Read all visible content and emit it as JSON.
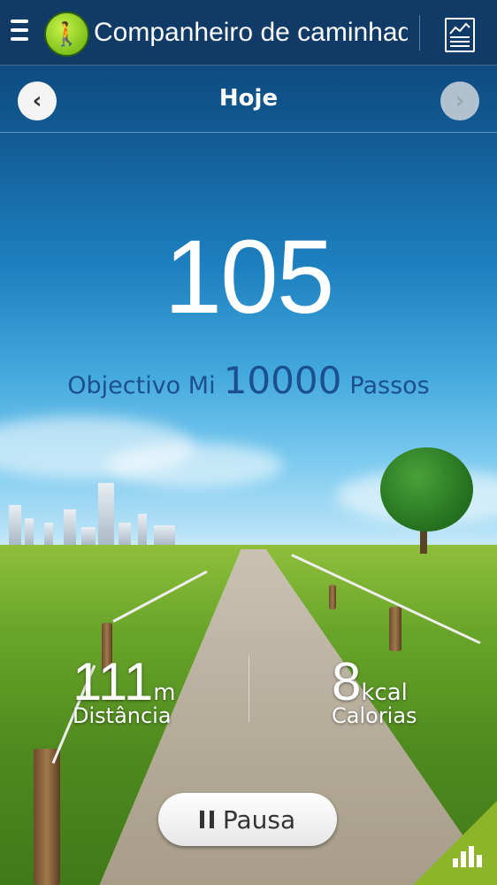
{
  "header": {
    "app_title": "Companheiro de caminhad",
    "menu_icon": "menu-icon",
    "app_icon": "walking-person-icon",
    "right_icon": "chart-report-icon"
  },
  "date_nav": {
    "label": "Hoje",
    "prev_icon": "chevron-left-icon",
    "next_icon": "chevron-right-icon"
  },
  "steps": {
    "count": "105",
    "goal_prefix": "Objectivo Mi",
    "goal_value": "10000",
    "goal_suffix": "Passos"
  },
  "stats": {
    "distance": {
      "value": "111",
      "unit": "m",
      "label": "Distância"
    },
    "calories": {
      "value": "8",
      "unit": "kcal",
      "label": "Calorias"
    }
  },
  "controls": {
    "pause_label": "Pausa",
    "corner_icon": "bar-chart-icon"
  },
  "colors": {
    "topbar": "#0f3b66",
    "goal_text": "#1b4f8f",
    "corner_tab": "#8db52a"
  }
}
